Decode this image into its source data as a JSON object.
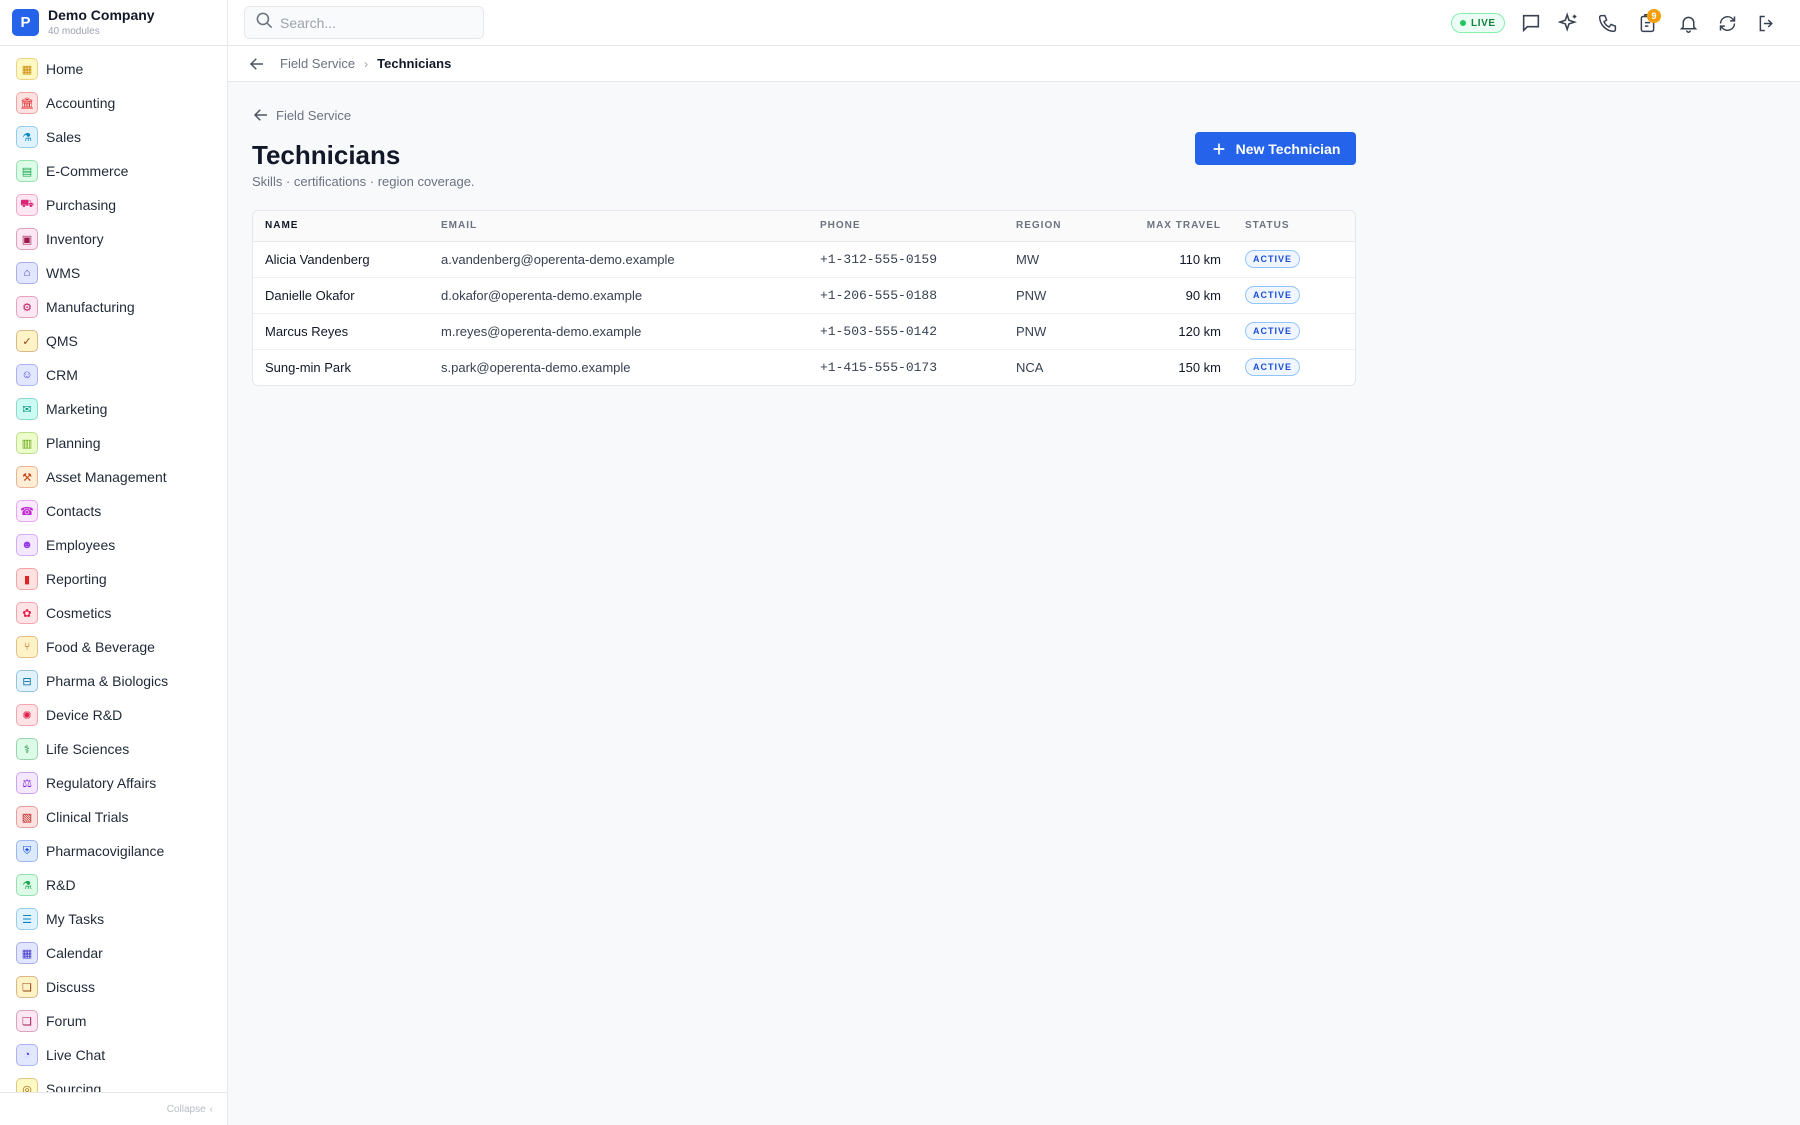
{
  "brand": {
    "logo_letter": "P",
    "name": "Demo Company",
    "subtitle": "40 modules"
  },
  "sidebar": {
    "items": [
      {
        "label": "Home",
        "icon": "grid-icon",
        "glyph": "▦",
        "color": "#ca8a04",
        "bg": "#fef9c3"
      },
      {
        "label": "Accounting",
        "icon": "bank-icon",
        "glyph": "🏛",
        "color": "#dc2626",
        "bg": "#fee2e2"
      },
      {
        "label": "Sales",
        "icon": "flask-icon",
        "glyph": "⚗",
        "color": "#0284c7",
        "bg": "#e0f2fe"
      },
      {
        "label": "E-Commerce",
        "icon": "store-icon",
        "glyph": "▤",
        "color": "#16a34a",
        "bg": "#dcfce7"
      },
      {
        "label": "Purchasing",
        "icon": "cart-icon",
        "glyph": "⛟",
        "color": "#db2777",
        "bg": "#fce7f3"
      },
      {
        "label": "Inventory",
        "icon": "box-icon",
        "glyph": "▣",
        "color": "#9d174d",
        "bg": "#fce7f3"
      },
      {
        "label": "WMS",
        "icon": "warehouse-icon",
        "glyph": "⌂",
        "color": "#4338ca",
        "bg": "#e0e7ff"
      },
      {
        "label": "Manufacturing",
        "icon": "factory-icon",
        "glyph": "⚙",
        "color": "#be185d",
        "bg": "#fce7f3"
      },
      {
        "label": "QMS",
        "icon": "badge-check-icon",
        "glyph": "✓",
        "color": "#92400e",
        "bg": "#fef3c7"
      },
      {
        "label": "CRM",
        "icon": "users-icon",
        "glyph": "☺",
        "color": "#4f46e5",
        "bg": "#e0e7ff"
      },
      {
        "label": "Marketing",
        "icon": "megaphone-icon",
        "glyph": "✉",
        "color": "#0d9488",
        "bg": "#ccfbf1"
      },
      {
        "label": "Planning",
        "icon": "clipboard-icon",
        "glyph": "▥",
        "color": "#65a30d",
        "bg": "#ecfccb"
      },
      {
        "label": "Asset Management",
        "icon": "tools-icon",
        "glyph": "⚒",
        "color": "#c2410c",
        "bg": "#ffedd5"
      },
      {
        "label": "Contacts",
        "icon": "contact-card-icon",
        "glyph": "☎",
        "color": "#c026d3",
        "bg": "#fae8ff"
      },
      {
        "label": "Employees",
        "icon": "id-badge-icon",
        "glyph": "☻",
        "color": "#9333ea",
        "bg": "#f3e8ff"
      },
      {
        "label": "Reporting",
        "icon": "bar-chart-icon",
        "glyph": "▮",
        "color": "#dc2626",
        "bg": "#fee2e2"
      },
      {
        "label": "Cosmetics",
        "icon": "lotus-icon",
        "glyph": "✿",
        "color": "#e11d48",
        "bg": "#ffe4e6"
      },
      {
        "label": "Food & Beverage",
        "icon": "utensils-icon",
        "glyph": "⑂",
        "color": "#b45309",
        "bg": "#fef3c7"
      },
      {
        "label": "Pharma & Biologics",
        "icon": "pill-bottle-icon",
        "glyph": "⊟",
        "color": "#0369a1",
        "bg": "#e0f2fe"
      },
      {
        "label": "Device R&D",
        "icon": "cog-icon",
        "glyph": "✺",
        "color": "#e11d48",
        "bg": "#ffe4e6"
      },
      {
        "label": "Life Sciences",
        "icon": "microscope-icon",
        "glyph": "⚕",
        "color": "#15803d",
        "bg": "#dcfce7"
      },
      {
        "label": "Regulatory Affairs",
        "icon": "gavel-icon",
        "glyph": "⚖",
        "color": "#7e22ce",
        "bg": "#f3e8ff"
      },
      {
        "label": "Clinical Trials",
        "icon": "clipboard-list-icon",
        "glyph": "▧",
        "color": "#b91c1c",
        "bg": "#fee2e2"
      },
      {
        "label": "Pharmacovigilance",
        "icon": "shield-icon",
        "glyph": "⛨",
        "color": "#1d4ed8",
        "bg": "#dbeafe"
      },
      {
        "label": "R&D",
        "icon": "beaker-icon",
        "glyph": "⚗",
        "color": "#16a34a",
        "bg": "#dcfce7"
      },
      {
        "label": "My Tasks",
        "icon": "checklist-icon",
        "glyph": "☰",
        "color": "#0284c7",
        "bg": "#e0f2fe"
      },
      {
        "label": "Calendar",
        "icon": "calendar-icon",
        "glyph": "▦",
        "color": "#4338ca",
        "bg": "#e0e7ff"
      },
      {
        "label": "Discuss",
        "icon": "chat-bubbles-icon",
        "glyph": "❏",
        "color": "#92400e",
        "bg": "#fef3c7"
      },
      {
        "label": "Forum",
        "icon": "forum-icon",
        "glyph": "❏",
        "color": "#9d174d",
        "bg": "#fce7f3"
      },
      {
        "label": "Live Chat",
        "icon": "headset-icon",
        "glyph": "◔",
        "color": "#4f46e5",
        "bg": "#e0e7ff"
      },
      {
        "label": "Sourcing",
        "icon": "sourcing-icon",
        "glyph": "◎",
        "color": "#a16207",
        "bg": "#fef9c3"
      }
    ],
    "collapse_label": "Collapse"
  },
  "topbar": {
    "search_placeholder": "Search...",
    "live_label": "LIVE",
    "notification_count": "9",
    "icons": [
      "chat-icon",
      "sparkles-icon",
      "phone-icon",
      "clipboard-notification-icon",
      "bell-icon",
      "refresh-icon",
      "logout-icon"
    ]
  },
  "breadcrumb": {
    "parent": "Field Service",
    "current": "Technicians"
  },
  "page": {
    "back_label": "Field Service",
    "title": "Technicians",
    "subtitle": "Skills · certifications · region coverage.",
    "new_button_label": "New Technician"
  },
  "table": {
    "headers": {
      "name": "NAME",
      "email": "EMAIL",
      "phone": "PHONE",
      "region": "REGION",
      "max_travel": "MAX TRAVEL",
      "status": "STATUS"
    },
    "rows": [
      {
        "name": "Alicia Vandenberg",
        "email": "a.vandenberg@operenta-demo.example",
        "phone": "+1-312-555-0159",
        "region": "MW",
        "max_travel": "110 km",
        "status": "ACTIVE"
      },
      {
        "name": "Danielle Okafor",
        "email": "d.okafor@operenta-demo.example",
        "phone": "+1-206-555-0188",
        "region": "PNW",
        "max_travel": "90 km",
        "status": "ACTIVE"
      },
      {
        "name": "Marcus Reyes",
        "email": "m.reyes@operenta-demo.example",
        "phone": "+1-503-555-0142",
        "region": "PNW",
        "max_travel": "120 km",
        "status": "ACTIVE"
      },
      {
        "name": "Sung-min Park",
        "email": "s.park@operenta-demo.example",
        "phone": "+1-415-555-0173",
        "region": "NCA",
        "max_travel": "150 km",
        "status": "ACTIVE"
      }
    ]
  },
  "colors": {
    "accent": "#2563eb",
    "live": "#22c55e",
    "badge": "#f59e0b"
  }
}
